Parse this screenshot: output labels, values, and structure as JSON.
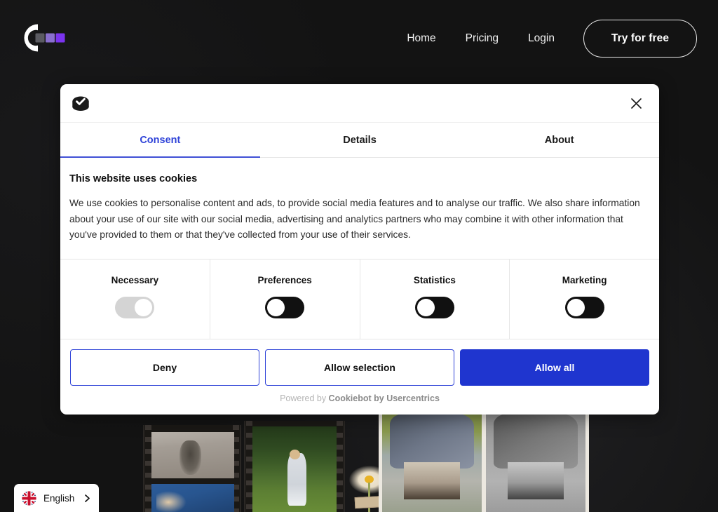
{
  "site": {
    "logo_name": "colorize-logo",
    "background_color": "#131313"
  },
  "nav": {
    "links": [
      {
        "label": "Home",
        "name": "nav-link-home"
      },
      {
        "label": "Pricing",
        "name": "nav-link-pricing"
      },
      {
        "label": "Login",
        "name": "nav-link-login"
      }
    ],
    "cta_label": "Try for free"
  },
  "cookie_dialog": {
    "brand_icon": "cookiebot-cookie-icon",
    "close_icon": "close-icon",
    "tabs": [
      {
        "label": "Consent",
        "active": true
      },
      {
        "label": "Details",
        "active": false
      },
      {
        "label": "About",
        "active": false
      }
    ],
    "active_tab_color": "#2f43d8",
    "heading": "This website uses cookies",
    "body": "We use cookies to personalise content and ads, to provide social media features and to analyse our traffic. We also share information about your use of our site with our social media, advertising and analytics partners who may combine it with other information that you've provided to them or that they've collected from your use of their services.",
    "categories": [
      {
        "label": "Necessary",
        "state": "on",
        "locked": true,
        "toggle_color": "#d4d4d4"
      },
      {
        "label": "Preferences",
        "state": "off",
        "locked": false,
        "toggle_color": "#111111"
      },
      {
        "label": "Statistics",
        "state": "off",
        "locked": false,
        "toggle_color": "#111111"
      },
      {
        "label": "Marketing",
        "state": "off",
        "locked": false,
        "toggle_color": "#111111"
      }
    ],
    "buttons": {
      "deny": "Deny",
      "allow_selection": "Allow selection",
      "allow_all": "Allow all",
      "primary_color": "#1f35cf"
    },
    "footer": {
      "powered_by": "Powered by ",
      "brand": "Cookiebot by Usercentrics"
    }
  },
  "language_selector": {
    "flag_icon": "uk-flag-icon",
    "label": "English",
    "chevron_icon": "chevron-right-icon"
  }
}
